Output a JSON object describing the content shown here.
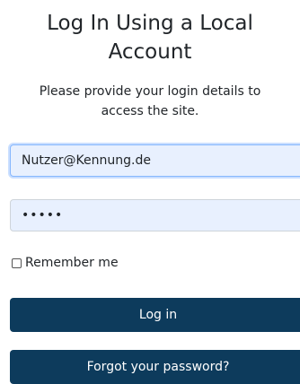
{
  "header": {
    "title": "Log In Using a Local Account",
    "subtitle": "Please provide your login details to access the site."
  },
  "form": {
    "email_value": "Nutzer@Kennung.de",
    "password_display": "•••••",
    "remember_label": "Remember me",
    "remember_checked": false,
    "login_label": "Log in",
    "forgot_label": "Forgot your password?"
  },
  "colors": {
    "button_bg": "#0d3b5c",
    "input_autofill_bg": "#e8f0fe",
    "focus_border": "#86b7fe"
  }
}
